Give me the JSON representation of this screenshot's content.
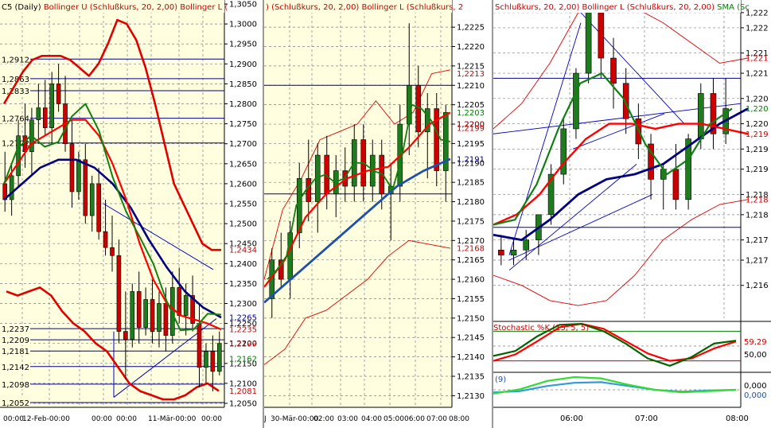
{
  "colors": {
    "bg_yellow": "#FFFFE0",
    "bg_white": "#FFFFFF",
    "grid": "#808080",
    "bull": "#1E7B1E",
    "bear": "#CC0000",
    "band": "#E00000",
    "sma_red": "#FF0000",
    "sma_green": "#108010",
    "sma_navy": "#000080",
    "sma_blue": "#1E4FB0",
    "hline": "#00008B",
    "price_red": "#CC0000",
    "price_green": "#008000",
    "stoch_k": "#006400",
    "stoch_d": "#FF0000",
    "osc_green": "#33DD33",
    "osc_blue": "#3399DD"
  },
  "panes": [
    {
      "id": "daily",
      "title_parts": [
        {
          "text": "C5 (Daily)",
          "color": "#000000"
        },
        {
          "text": "Bollinger U (Schlußkurs, 20, 2,00)",
          "color": "#CC0000"
        },
        {
          "text": "Bollinger L (",
          "color": "#CC0000"
        }
      ],
      "y_ticks": [
        "1,3050",
        "1,3000",
        "1,2950",
        "1,2900",
        "1,2850",
        "1,2800",
        "1,2750",
        "1,2700",
        "1,2650",
        "1,2600",
        "1,2550",
        "1,2500",
        "1,2450",
        "1,2400",
        "1,2350",
        "1,2300",
        "1,2250",
        "1,2200",
        "1,2150",
        "1,2100",
        "1,2050"
      ],
      "price_labels": [
        {
          "text": "1,2434",
          "color": "#CC0000",
          "value": 1.2434
        },
        {
          "text": "1,2265",
          "color": "#00008B",
          "value": 1.2265
        },
        {
          "text": "1,2235",
          "color": "#CC0000",
          "value": 1.2235
        },
        {
          "text": "1,2199",
          "color": "#CC0000",
          "value": 1.2199
        },
        {
          "text": "1,2162",
          "color": "#008000",
          "value": 1.2162
        },
        {
          "text": "1,2081",
          "color": "#CC0000",
          "value": 1.2081
        }
      ],
      "hline_labels": [
        "1,2912",
        "1,2863",
        "1,2833",
        "1,2764",
        "1,2702",
        "1,2237",
        "1,2209",
        "1,2181",
        "1,2142",
        "1,2098",
        "1,2052"
      ],
      "x_labels": [
        "00:00",
        "12-Feb-00:00",
        "00:00",
        "00:00",
        "11-Mär-00:00",
        "00:00"
      ]
    },
    {
      "id": "h1",
      "title_parts": [
        {
          "text": ") (Schlußkurs, 20, 2,00)",
          "color": "#CC0000"
        },
        {
          "text": "Bollinger L (Schlußkurs, 2",
          "color": "#CC0000"
        }
      ],
      "y_ticks": [
        "1,2225",
        "1,2220",
        "1,2215",
        "1,2210",
        "1,2205",
        "1,2200",
        "1,2195",
        "1,2190",
        "1,2185",
        "1,2180",
        "1,2175",
        "1,2170",
        "1,2165",
        "1,2160",
        "1,2155",
        "1,2150",
        "1,2145",
        "1,2140",
        "1,2135",
        "1,2130"
      ],
      "price_labels": [
        {
          "text": "1,2213",
          "color": "#CC0000",
          "value": 1.2213
        },
        {
          "text": "1,2203",
          "color": "#008000",
          "value": 1.2203
        },
        {
          "text": "1,2200",
          "color": "#CC0000",
          "value": 1.22
        },
        {
          "text": "1,2199",
          "color": "#CC0000",
          "value": 1.2199
        },
        {
          "text": "1,2191",
          "color": "#00008B",
          "value": 1.2191
        },
        {
          "text": "1,2168",
          "color": "#CC0000",
          "value": 1.2168
        }
      ],
      "x_labels": [
        "J",
        "30-Mär-00:00",
        "02:00",
        "03:00",
        "04:00",
        "05:00",
        "06:00",
        "07:00",
        "08:00"
      ]
    },
    {
      "id": "m5",
      "title_parts": [
        {
          "text": "Schlußkurs, 20, 2,00)",
          "color": "#CC0000"
        },
        {
          "text": "Bollinger L (Schlußkurs, 20, 2,00)",
          "color": "#CC0000"
        },
        {
          "text": "SMA (Sc",
          "color": "#008000"
        }
      ],
      "y_ticks": [
        "1,222",
        "1,222",
        "1,221",
        "1,221",
        "1,220",
        "1,220",
        "1,219",
        "1,219",
        "1,218",
        "1,218",
        "1,217",
        "1,217",
        "1,216"
      ],
      "price_labels": [
        {
          "text": "1,221",
          "color": "#CC0000",
          "value": 1.2213
        },
        {
          "text": "1,220",
          "color": "#008000",
          "value": 1.2203
        },
        {
          "text": "1,219",
          "color": "#CC0000",
          "value": 1.2198
        },
        {
          "text": "1,218",
          "color": "#CC0000",
          "value": 1.2185
        }
      ],
      "x_labels": [
        "06:00",
        "07:00",
        "08:00"
      ],
      "stoch": {
        "title": "Stochastic %K (15, 5, 5)",
        "labels": [
          {
            "text": "59,29",
            "color": "#CC0000"
          },
          {
            "text": "50,00",
            "color": "#000000"
          }
        ]
      },
      "osc": {
        "title": "(9)",
        "labels": [
          {
            "text": "0,000",
            "color": "#000000"
          },
          {
            "text": "0,000",
            "color": "#1E4FB0"
          }
        ]
      }
    }
  ],
  "chart_data": [
    {
      "type": "line",
      "title": "C5 (Daily)",
      "ylim": [
        1.204,
        1.306
      ],
      "grid": true,
      "ohlc": [
        [
          1.26,
          1.268,
          1.253,
          1.256
        ],
        [
          1.256,
          1.265,
          1.252,
          1.262
        ],
        [
          1.262,
          1.276,
          1.259,
          1.272
        ],
        [
          1.272,
          1.28,
          1.264,
          1.268
        ],
        [
          1.268,
          1.279,
          1.262,
          1.276
        ],
        [
          1.276,
          1.285,
          1.27,
          1.279
        ],
        [
          1.279,
          1.286,
          1.272,
          1.274
        ],
        [
          1.274,
          1.288,
          1.27,
          1.285
        ],
        [
          1.285,
          1.29,
          1.278,
          1.28
        ],
        [
          1.28,
          1.287,
          1.268,
          1.27
        ],
        [
          1.27,
          1.276,
          1.254,
          1.258
        ],
        [
          1.258,
          1.268,
          1.256,
          1.266
        ],
        [
          1.266,
          1.27,
          1.25,
          1.252
        ],
        [
          1.252,
          1.262,
          1.248,
          1.26
        ],
        [
          1.26,
          1.264,
          1.246,
          1.248
        ],
        [
          1.248,
          1.256,
          1.242,
          1.244
        ],
        [
          1.244,
          1.252,
          1.238,
          1.242
        ],
        [
          1.242,
          1.246,
          1.22,
          1.223
        ],
        [
          1.223,
          1.233,
          1.211,
          1.221
        ],
        [
          1.221,
          1.235,
          1.219,
          1.233
        ],
        [
          1.233,
          1.238,
          1.22,
          1.224
        ],
        [
          1.224,
          1.234,
          1.222,
          1.231
        ],
        [
          1.231,
          1.236,
          1.22,
          1.223
        ],
        [
          1.223,
          1.233,
          1.219,
          1.23
        ],
        [
          1.23,
          1.234,
          1.218,
          1.222
        ],
        [
          1.222,
          1.238,
          1.22,
          1.234
        ],
        [
          1.234,
          1.239,
          1.225,
          1.227
        ],
        [
          1.227,
          1.235,
          1.222,
          1.232
        ],
        [
          1.232,
          1.237,
          1.223,
          1.225
        ],
        [
          1.225,
          1.23,
          1.209,
          1.214
        ],
        [
          1.214,
          1.22,
          1.21,
          1.218
        ],
        [
          1.218,
          1.222,
          1.208,
          1.213
        ],
        [
          1.213,
          1.223,
          1.212,
          1.22
        ]
      ],
      "bollinger_upper": [
        1.28,
        1.284,
        1.288,
        1.291,
        1.292,
        1.292,
        1.292,
        1.291,
        1.289,
        1.287,
        1.29,
        1.295,
        1.301,
        1.3,
        1.296,
        1.289,
        1.28,
        1.27,
        1.26,
        1.255,
        1.25,
        1.245,
        1.2434,
        1.2434
      ],
      "bollinger_lower": [
        1.233,
        1.232,
        1.233,
        1.234,
        1.232,
        1.228,
        1.225,
        1.223,
        1.22,
        1.218,
        1.214,
        1.21,
        1.208,
        1.207,
        1.206,
        1.206,
        1.207,
        1.209,
        1.21,
        1.2081
      ],
      "sma_fast": [
        1.26,
        1.265,
        1.27,
        1.272,
        1.274,
        1.276,
        1.276,
        1.272,
        1.265,
        1.256,
        1.245,
        1.236,
        1.23,
        1.227,
        1.226,
        1.225,
        1.2235
      ],
      "sma_slow": [
        1.256,
        1.26,
        1.264,
        1.266,
        1.266,
        1.264,
        1.26,
        1.254,
        1.246,
        1.239,
        1.233,
        1.229,
        1.2265
      ]
    },
    {
      "type": "line",
      "title": "Bollinger (Schlußkurs, 20, 2,00)",
      "x": [
        "30-Mär-00:00",
        "02:00",
        "03:00",
        "04:00",
        "05:00",
        "06:00",
        "07:00",
        "08:00"
      ],
      "ylim": [
        1.2127,
        1.2232
      ],
      "grid": true,
      "ohlc": [
        [
          1.2155,
          1.2168,
          1.215,
          1.2165
        ],
        [
          1.2165,
          1.2172,
          1.2158,
          1.216
        ],
        [
          1.216,
          1.2175,
          1.2155,
          1.2172
        ],
        [
          1.2172,
          1.219,
          1.2168,
          1.2186
        ],
        [
          1.2186,
          1.2196,
          1.2175,
          1.218
        ],
        [
          1.218,
          1.2195,
          1.2172,
          1.2192
        ],
        [
          1.2192,
          1.2197,
          1.2178,
          1.2182
        ],
        [
          1.2182,
          1.2192,
          1.2176,
          1.2188
        ],
        [
          1.2188,
          1.2194,
          1.218,
          1.2184
        ],
        [
          1.2184,
          1.22,
          1.218,
          1.2196
        ],
        [
          1.2196,
          1.22,
          1.218,
          1.2184
        ],
        [
          1.2184,
          1.2196,
          1.218,
          1.2192
        ],
        [
          1.2192,
          1.2196,
          1.2178,
          1.2182
        ],
        [
          1.2182,
          1.219,
          1.217,
          1.2184
        ],
        [
          1.2184,
          1.2205,
          1.218,
          1.22
        ],
        [
          1.22,
          1.2226,
          1.2192,
          1.221
        ],
        [
          1.221,
          1.2215,
          1.2194,
          1.2198
        ],
        [
          1.2198,
          1.2208,
          1.2186,
          1.2204
        ],
        [
          1.2204,
          1.2208,
          1.2184,
          1.2188
        ],
        [
          1.2188,
          1.2205,
          1.218,
          1.2203
        ]
      ],
      "bollinger_upper": [
        1.2175,
        1.2172,
        1.218,
        1.219,
        1.2196,
        1.2198,
        1.22,
        1.2201,
        1.2203,
        1.221,
        1.2213
      ],
      "bollinger_lower": [
        1.214,
        1.2146,
        1.215,
        1.2152,
        1.2158,
        1.2168,
        1.217,
        1.2168
      ],
      "sma_fast": [
        1.2158,
        1.2165,
        1.2176,
        1.2182,
        1.2186,
        1.2188,
        1.2189,
        1.2194,
        1.22,
        1.2203
      ],
      "sma_slow": [
        1.2154,
        1.216,
        1.2166,
        1.2172,
        1.2178,
        1.2184,
        1.2188,
        1.2191
      ]
    },
    {
      "type": "line",
      "title": "SMA (Sc",
      "x": [
        "06:00",
        "07:00",
        "08:00"
      ],
      "ylim": [
        1.21615,
        1.22245
      ],
      "grid": true,
      "ohlc": [
        [
          1.2175,
          1.2178,
          1.2172,
          1.2174
        ],
        [
          1.2174,
          1.2177,
          1.2172,
          1.2175
        ],
        [
          1.2175,
          1.2179,
          1.2173,
          1.2177
        ],
        [
          1.2177,
          1.218,
          1.2174,
          1.2182
        ],
        [
          1.2182,
          1.2192,
          1.218,
          1.219
        ],
        [
          1.219,
          1.2201,
          1.2188,
          1.2199
        ],
        [
          1.2199,
          1.2211,
          1.2197,
          1.221
        ],
        [
          1.221,
          1.2223,
          1.2208,
          1.2222
        ],
        [
          1.2222,
          1.2224,
          1.2209,
          1.2213
        ],
        [
          1.2213,
          1.2217,
          1.2203,
          1.2208
        ],
        [
          1.2208,
          1.2211,
          1.2198,
          1.2201
        ],
        [
          1.2201,
          1.2204,
          1.2193,
          1.2196
        ],
        [
          1.2196,
          1.2198,
          1.2185,
          1.2189
        ],
        [
          1.2189,
          1.2192,
          1.2183,
          1.2191
        ],
        [
          1.2191,
          1.2196,
          1.2183,
          1.2185
        ],
        [
          1.2185,
          1.2198,
          1.2183,
          1.2197
        ],
        [
          1.2197,
          1.2208,
          1.2195,
          1.2206
        ],
        [
          1.2206,
          1.2209,
          1.2195,
          1.2198
        ],
        [
          1.2198,
          1.2209,
          1.2196,
          1.2203
        ]
      ],
      "bollinger_upper": [
        1.2199,
        1.2204,
        1.2212,
        1.2222,
        1.2224,
        1.2223,
        1.222,
        1.2216,
        1.2212,
        1.2213
      ],
      "bollinger_lower": [
        1.217,
        1.2168,
        1.2165,
        1.2164,
        1.2165,
        1.217,
        1.2177,
        1.2181,
        1.2184,
        1.2185
      ],
      "sma_fast": [
        1.218,
        1.2181,
        1.2188,
        1.2199,
        1.2208,
        1.221,
        1.2205,
        1.2196,
        1.219,
        1.2193,
        1.22,
        1.2203
      ],
      "sma_red": [
        1.218,
        1.2182,
        1.2186,
        1.2192,
        1.2197,
        1.22,
        1.22,
        1.2199,
        1.22,
        1.22,
        1.2199,
        1.2198
      ],
      "sma_slow": [
        1.2178,
        1.2177,
        1.2181,
        1.2186,
        1.2189,
        1.219,
        1.2192,
        1.2196,
        1.22,
        1.2203
      ],
      "stoch_k": [
        30,
        40,
        70,
        93,
        95,
        80,
        55,
        25,
        10,
        28,
        55,
        61
      ],
      "stoch_d": [
        20,
        33,
        60,
        88,
        95,
        85,
        60,
        35,
        20,
        25,
        45,
        59.29
      ],
      "osc_a": [
        -0.3,
        0.05,
        0.7,
        1.0,
        0.9,
        0.4,
        0.0,
        -0.2,
        -0.1,
        0.0
      ],
      "osc_b": [
        -0.2,
        -0.1,
        0.3,
        0.55,
        0.6,
        0.3,
        0.0,
        -0.15,
        -0.05,
        0.0
      ]
    }
  ]
}
